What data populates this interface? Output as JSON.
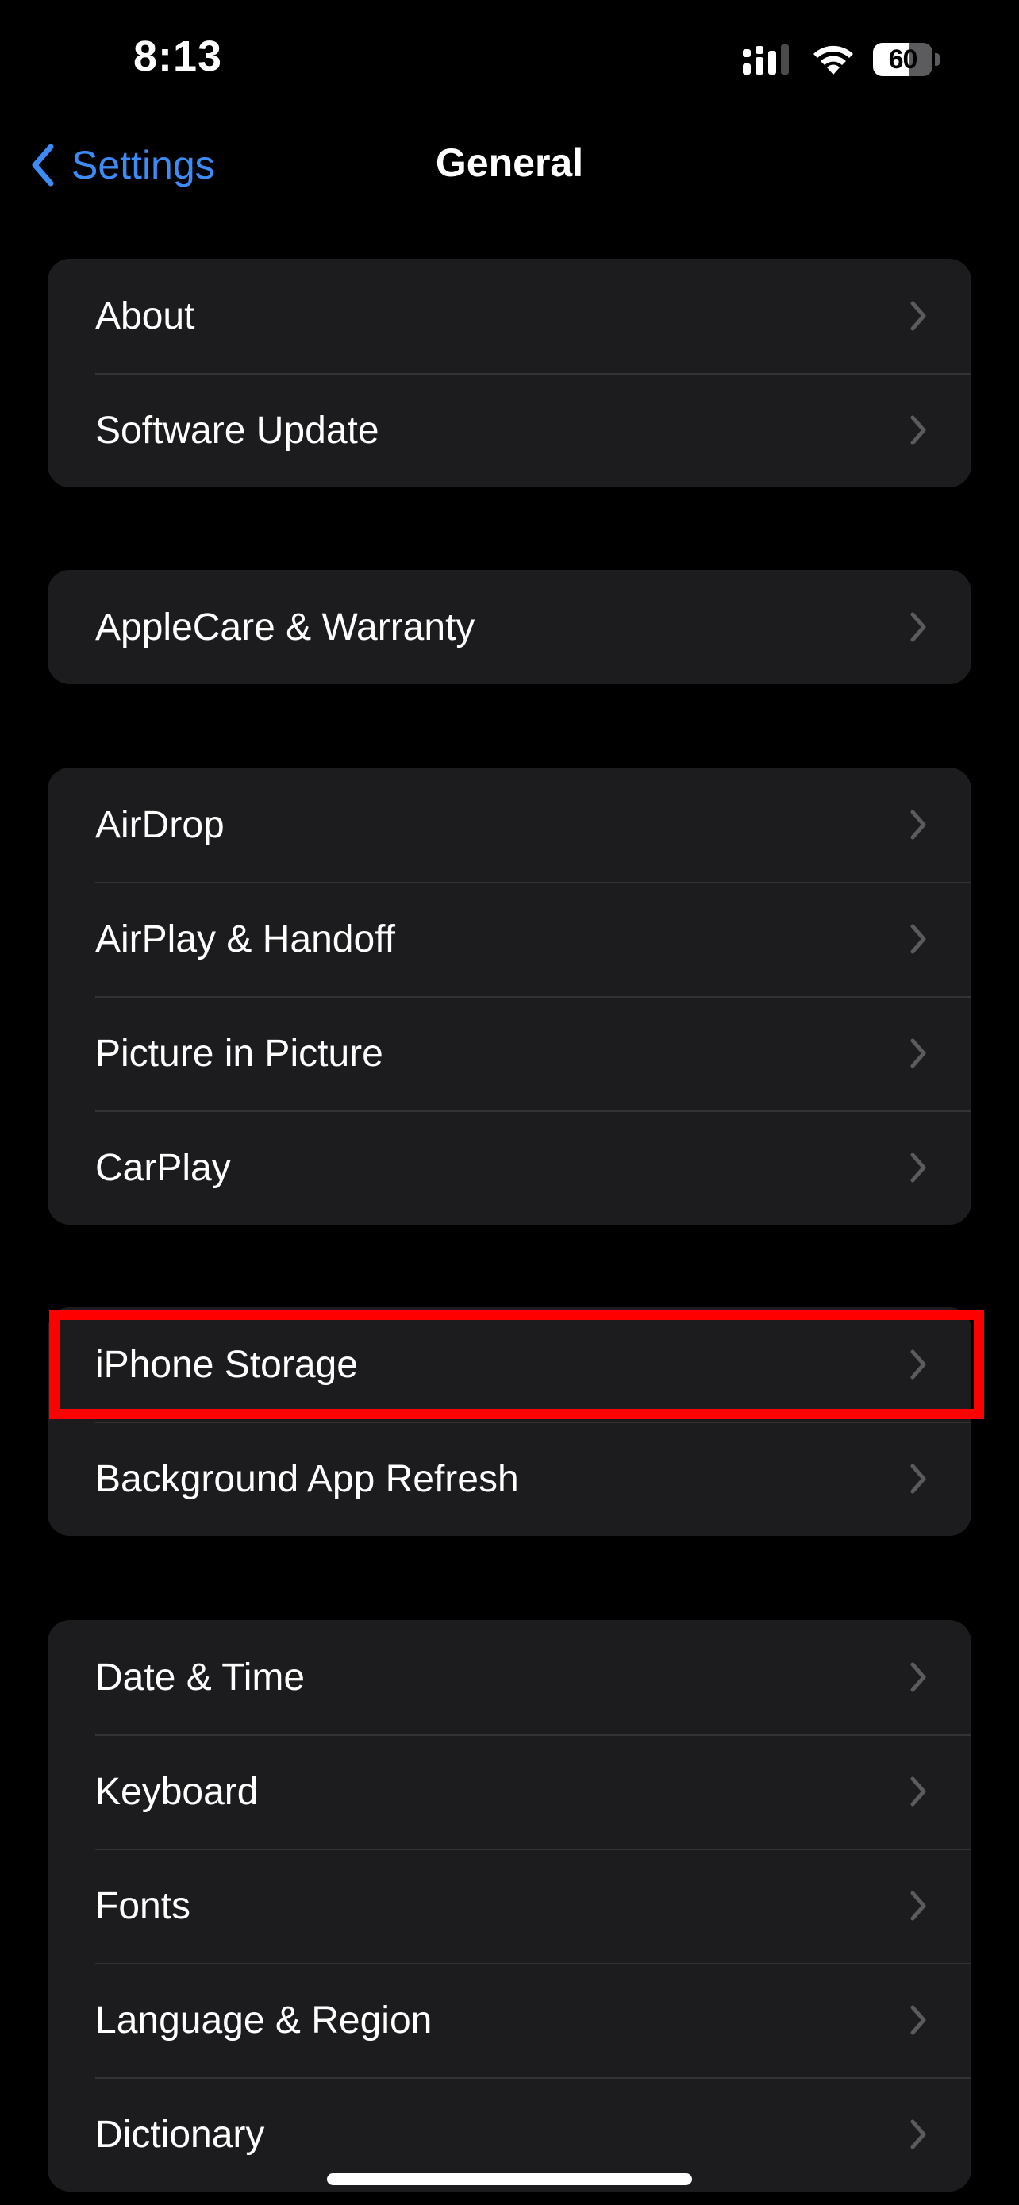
{
  "status_bar": {
    "time": "8:13",
    "battery_level": "60",
    "battery_fraction": 0.6,
    "icons": [
      "cellular-signal-icon",
      "wifi-icon",
      "battery-icon"
    ]
  },
  "nav": {
    "back_label": "Settings",
    "title": "General",
    "back_icon": "chevron-left-icon"
  },
  "groups": [
    {
      "items": [
        {
          "label": "About"
        },
        {
          "label": "Software Update"
        }
      ]
    },
    {
      "items": [
        {
          "label": "AppleCare & Warranty"
        }
      ]
    },
    {
      "items": [
        {
          "label": "AirDrop"
        },
        {
          "label": "AirPlay & Handoff"
        },
        {
          "label": "Picture in Picture"
        },
        {
          "label": "CarPlay"
        }
      ]
    },
    {
      "items": [
        {
          "label": "iPhone Storage",
          "highlighted": true
        },
        {
          "label": "Background App Refresh"
        }
      ]
    },
    {
      "items": [
        {
          "label": "Date & Time"
        },
        {
          "label": "Keyboard"
        },
        {
          "label": "Fonts"
        },
        {
          "label": "Language & Region"
        },
        {
          "label": "Dictionary"
        }
      ]
    }
  ],
  "colors": {
    "background": "#000000",
    "cell_background": "#1c1c1e",
    "accent": "#3d8bf6",
    "highlight": "#ff0000",
    "chevron": "#5b5b5f"
  }
}
